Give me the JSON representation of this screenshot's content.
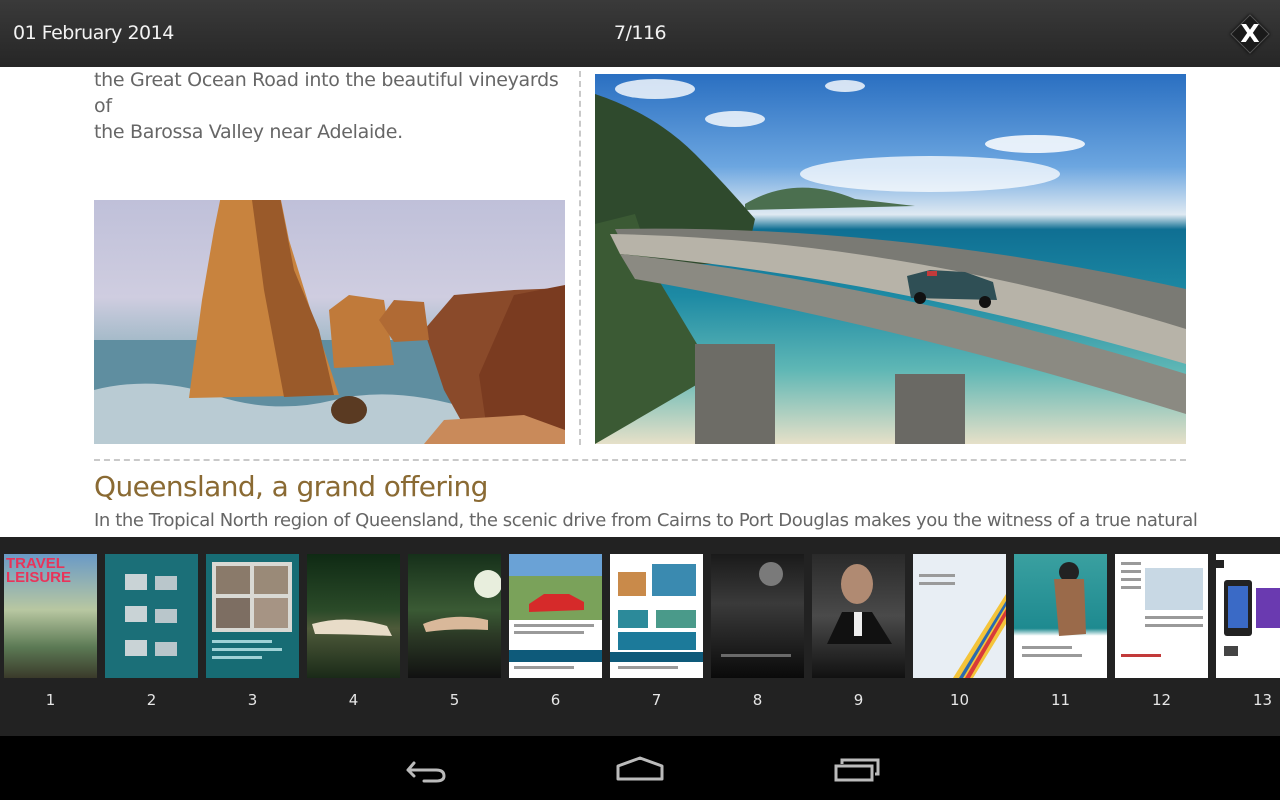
{
  "topbar": {
    "date": "01 February 2014",
    "page_indicator": "7/116",
    "close_label": "X"
  },
  "article": {
    "intro_lines": [
      "the Great Ocean Road into the beautiful vineyards of",
      "the Barossa Valley near Adelaide."
    ],
    "heading": "Queensland, a grand offering",
    "body": "In the Tropical North region of Queensland, the scenic drive from Cairns to Port Douglas makes you the witness of a true natural",
    "heading_color": "#8a6a33"
  },
  "thumbnails": [
    {
      "number": "1"
    },
    {
      "number": "2"
    },
    {
      "number": "3"
    },
    {
      "number": "4"
    },
    {
      "number": "5"
    },
    {
      "number": "6"
    },
    {
      "number": "7"
    },
    {
      "number": "8"
    },
    {
      "number": "9"
    },
    {
      "number": "10"
    },
    {
      "number": "11"
    },
    {
      "number": "12"
    },
    {
      "number": "13"
    }
  ],
  "thumbnail_cover_text": "TRAVEL LEISURE",
  "navbar": {
    "icons": [
      "back-icon",
      "home-icon",
      "recent-apps-icon"
    ]
  }
}
